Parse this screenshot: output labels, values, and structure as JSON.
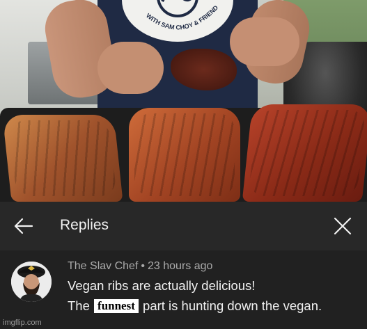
{
  "video": {
    "shirt_logo_text": "WITH SAM CHOY & FRIENDS"
  },
  "replies_header": {
    "back_icon": "arrow-left-icon",
    "title": "Replies",
    "close_icon": "close-icon"
  },
  "comment": {
    "author": "The Slav Chef",
    "separator": "•",
    "time": "23 hours ago",
    "line1": "Vegan ribs are actually delicious!",
    "line2_before": "The",
    "line2_edit": "funnest",
    "line2_after": "part is hunting down the vegan."
  },
  "watermark": "imgflip.com",
  "colors": {
    "panel_bg": "#212121",
    "header_bg": "#282828",
    "text_primary": "#f1f1f1",
    "text_secondary": "#aaaaaa"
  }
}
